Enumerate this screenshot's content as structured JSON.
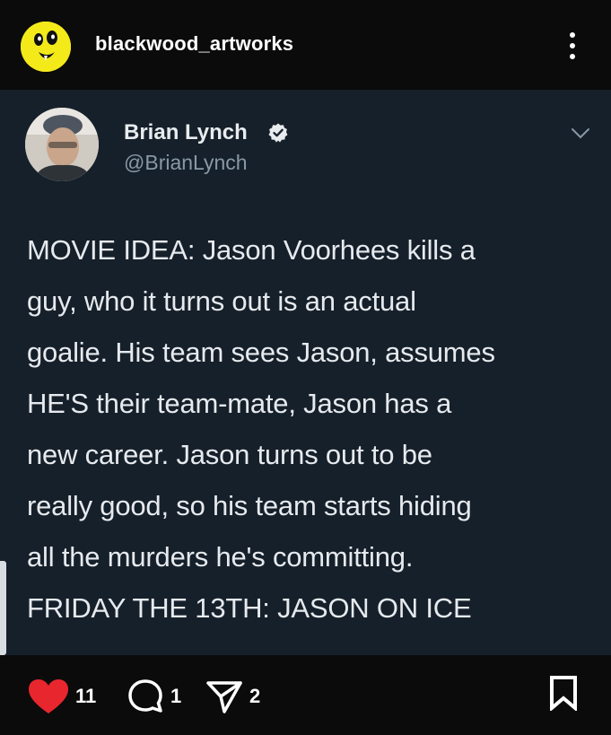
{
  "post": {
    "username": "blackwood_artworks",
    "avatar_icon": "yellow-cartoon-face-icon"
  },
  "tweet": {
    "display_name": "Brian Lynch",
    "handle": "@BrianLynch",
    "verified": true,
    "lines": [
      "MOVIE IDEA: Jason Voorhees kills a",
      "guy, who it turns out is an actual",
      "goalie.  His team sees Jason, assumes",
      "HE'S their team-mate, Jason has a",
      "new career.  Jason turns out to be",
      "really good, so his team starts hiding",
      "all the murders he's committing.",
      "FRIDAY THE 13TH: JASON ON ICE"
    ]
  },
  "actions": {
    "likes": "11",
    "comments": "1",
    "shares": "2"
  },
  "colors": {
    "like_red": "#e8262e",
    "tweet_bg": "#16202a",
    "handle_gray": "#8899a6",
    "avatar_yellow": "#f4ea1a"
  }
}
